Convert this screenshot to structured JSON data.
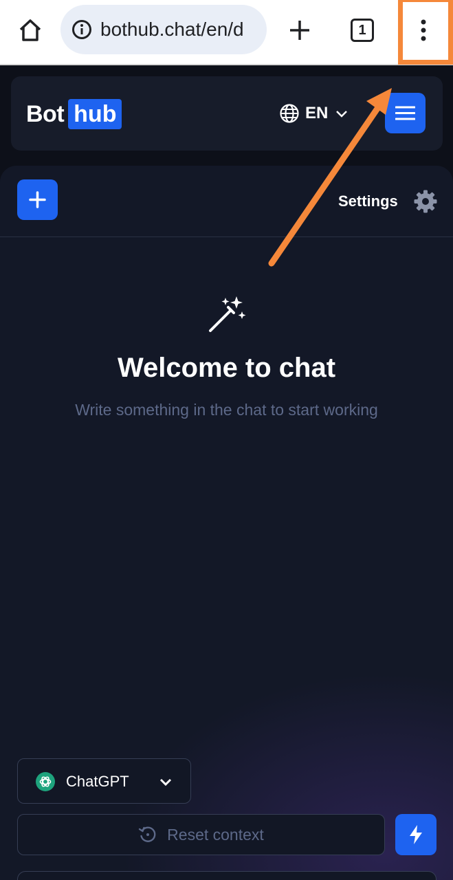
{
  "browser": {
    "url": "bothub.chat/en/d",
    "tab_count": "1"
  },
  "header": {
    "logo_bot": "Bot",
    "logo_hub": "hub",
    "language": "EN"
  },
  "toolbar": {
    "settings_label": "Settings"
  },
  "welcome": {
    "title": "Welcome to chat",
    "subtitle": "Write something in the chat to start working"
  },
  "composer": {
    "model_name": "ChatGPT",
    "reset_label": "Reset context"
  },
  "colors": {
    "accent": "#1e63f0",
    "highlight": "#f5883a",
    "panel": "#131827"
  }
}
